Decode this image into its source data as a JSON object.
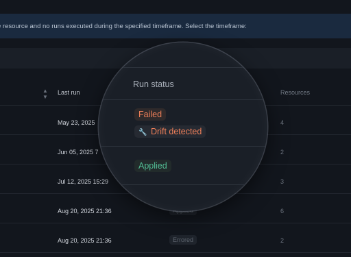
{
  "banner": {
    "text": "e resource and no runs executed during the specified timeframe. Select the timeframe:"
  },
  "table": {
    "headers": {
      "last_run": "Last run",
      "resources": "Resources"
    },
    "rows": [
      {
        "date": "May 23, 2025",
        "resources": "4",
        "status": ""
      },
      {
        "date": "Jun 05, 2025 7",
        "resources": "2",
        "status": ""
      },
      {
        "date": "Jul 12, 2025 15:29",
        "resources": "3",
        "status": ""
      },
      {
        "date": "Aug 20, 2025 21:36",
        "resources": "6",
        "status": "Applied"
      },
      {
        "date": "Aug 20, 2025 21:36",
        "resources": "2",
        "status": "Errored"
      }
    ]
  },
  "lens": {
    "title": "Run status",
    "badges": {
      "failed": "Failed",
      "drift": "Drift detected",
      "applied": "Applied"
    }
  },
  "colors": {
    "failed": "#f0805a",
    "applied": "#53bf95",
    "banner_bg": "#1a2a3f"
  },
  "icons": {
    "drift": "wrench-icon",
    "sort": "sort-arrows-icon"
  }
}
